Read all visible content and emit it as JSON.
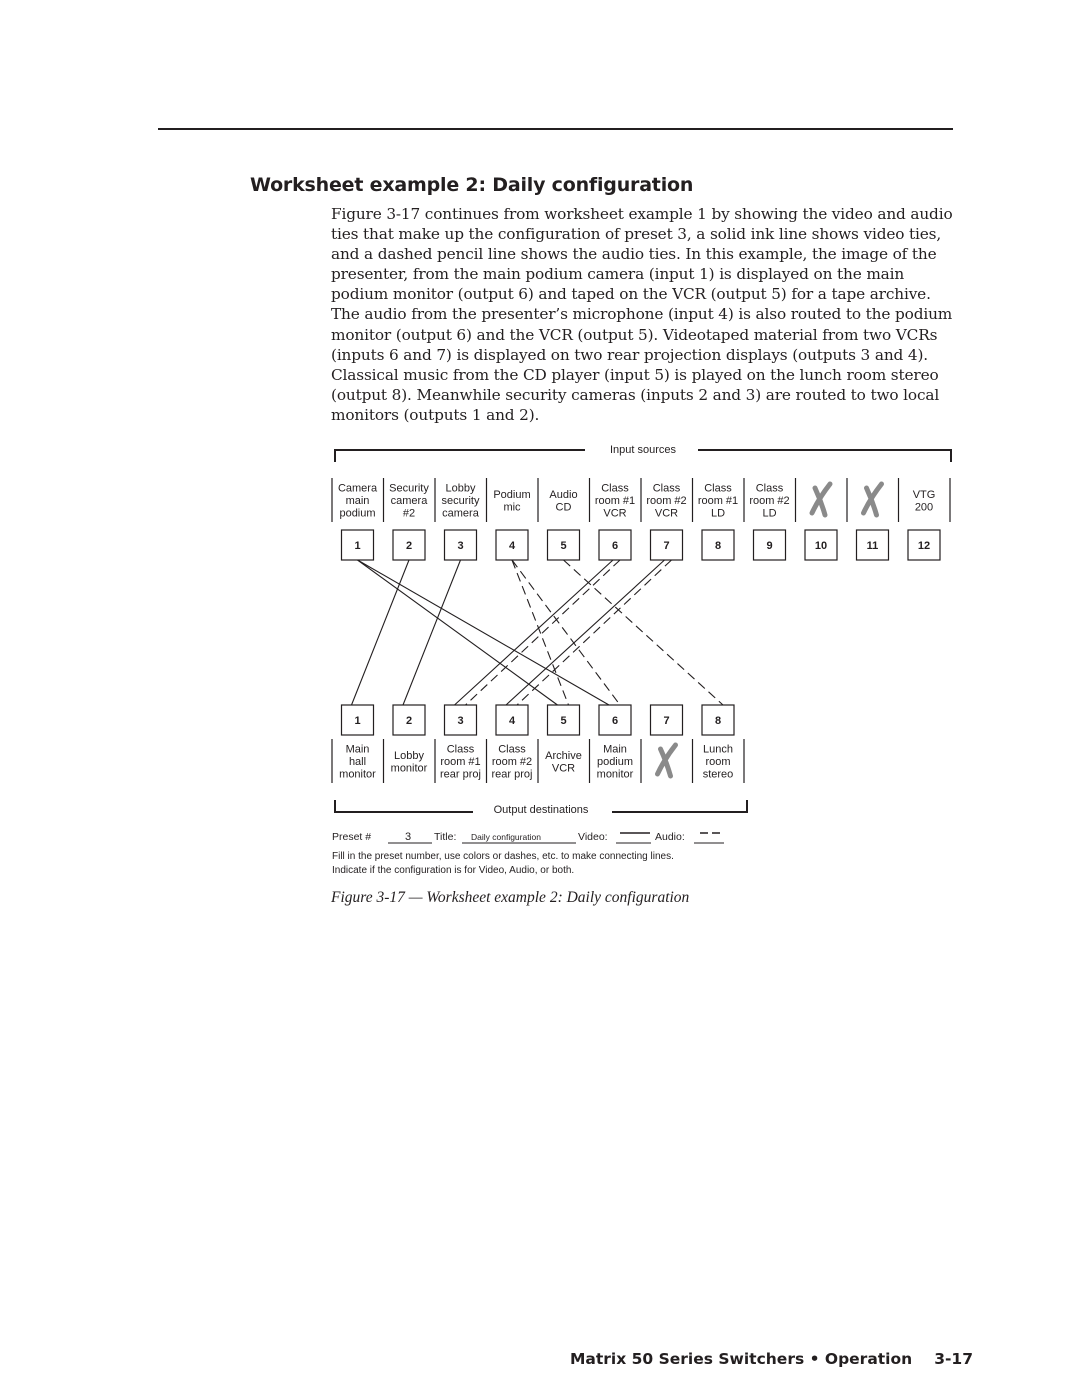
{
  "page": {
    "heading": "Worksheet example 2:  Daily configuration",
    "body": "Figure 3-17 continues from worksheet example 1 by showing the video and audio ties that make up the configuration of preset 3, a solid ink line shows video ties, and a dashed pencil line shows the audio ties. In this example, the image of the presenter, from the main podium camera (input 1) is displayed on the main podium monitor (output 6) and taped on the VCR (output 5) for a tape archive. The audio from the presenter’s microphone (input 4) is also routed to the podium monitor (output 6) and the VCR (output 5). Videotaped material from two VCRs (inputs 6 and 7) is displayed on two rear projection displays (outputs 3 and 4). Classical music from the CD player (input 5) is played on the lunch room stereo (output 8). Meanwhile security cameras (inputs 2 and 3) are routed to two local monitors (outputs 1 and 2).",
    "caption": "Figure 3-17 — Worksheet example 2:  Daily configuration",
    "footer_title": "Matrix 50 Series Switchers • Operation",
    "footer_page": "3-17"
  },
  "worksheet": {
    "inputs_label": "Input sources",
    "outputs_label": "Output destinations",
    "inputs": [
      {
        "num": "1",
        "lines": [
          "Camera",
          "main",
          "podium"
        ]
      },
      {
        "num": "2",
        "lines": [
          "Security",
          "camera",
          "#2"
        ]
      },
      {
        "num": "3",
        "lines": [
          "Lobby",
          "security",
          "camera"
        ]
      },
      {
        "num": "4",
        "lines": [
          "Podium",
          "mic"
        ]
      },
      {
        "num": "5",
        "lines": [
          "Audio",
          "CD"
        ]
      },
      {
        "num": "6",
        "lines": [
          "Class",
          "room #1",
          "VCR"
        ]
      },
      {
        "num": "7",
        "lines": [
          "Class",
          "room #2",
          "VCR"
        ]
      },
      {
        "num": "8",
        "lines": [
          "Class",
          "room #1",
          "LD"
        ]
      },
      {
        "num": "9",
        "lines": [
          "Class",
          "room #2",
          "LD"
        ]
      },
      {
        "num": "10",
        "lines": [],
        "unused": true
      },
      {
        "num": "11",
        "lines": [],
        "unused": true
      },
      {
        "num": "12",
        "lines": [
          "VTG",
          "200"
        ]
      }
    ],
    "outputs": [
      {
        "num": "1",
        "lines": [
          "Main",
          "hall",
          "monitor"
        ]
      },
      {
        "num": "2",
        "lines": [
          "Lobby",
          "monitor"
        ]
      },
      {
        "num": "3",
        "lines": [
          "Class",
          "room #1",
          "rear proj"
        ]
      },
      {
        "num": "4",
        "lines": [
          "Class",
          "room #2",
          "rear proj"
        ]
      },
      {
        "num": "5",
        "lines": [
          "Archive",
          "VCR"
        ]
      },
      {
        "num": "6",
        "lines": [
          "Main",
          "podium",
          "monitor"
        ]
      },
      {
        "num": "7",
        "lines": [],
        "unused": true
      },
      {
        "num": "8",
        "lines": [
          "Lunch",
          "room",
          "stereo"
        ]
      }
    ],
    "video_ties": [
      [
        1,
        5
      ],
      [
        1,
        6
      ],
      [
        2,
        1
      ],
      [
        3,
        2
      ],
      [
        6,
        3
      ],
      [
        7,
        4
      ]
    ],
    "audio_ties": [
      [
        4,
        5
      ],
      [
        4,
        6
      ],
      [
        5,
        8
      ],
      [
        6,
        3
      ],
      [
        7,
        4
      ]
    ],
    "form": {
      "preset_label": "Preset #",
      "preset_value": "3",
      "title_label": "Title:",
      "title_value": "Daily configuration",
      "video_label": "Video:",
      "audio_label": "Audio:",
      "instructions_1": "Fill in the preset number, use colors or dashes, etc. to make connecting lines.",
      "instructions_2": "Indicate if the configuration is for Video, Audio, or both."
    },
    "colors": {
      "ink": "#231f20",
      "unused_x": "#8a8a8a"
    }
  }
}
